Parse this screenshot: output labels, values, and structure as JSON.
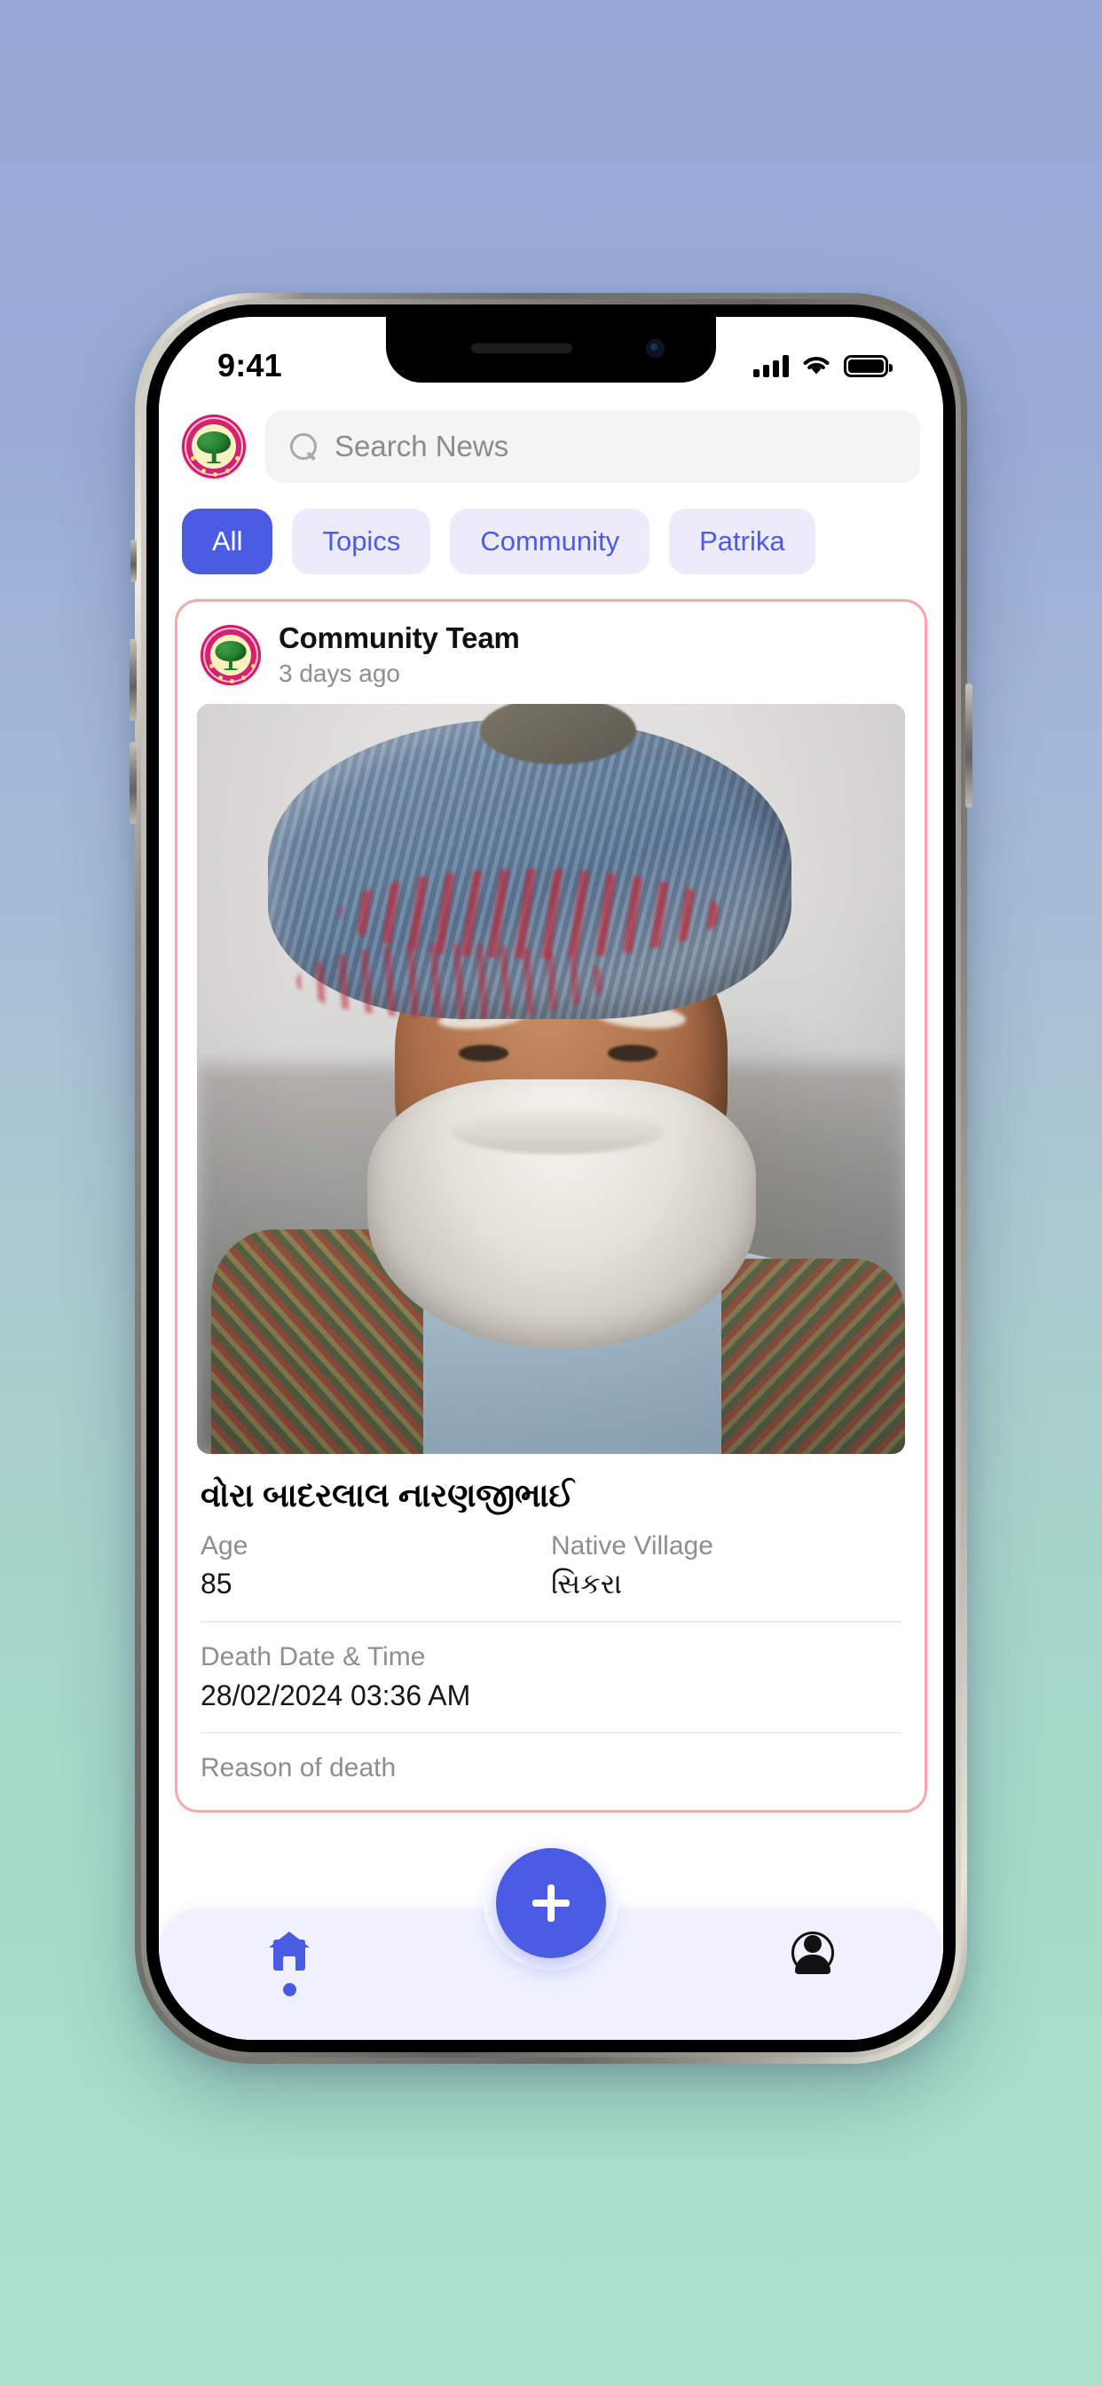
{
  "status_bar": {
    "time": "9:41",
    "cellular_icon": "cellular-signal-icon",
    "wifi_icon": "wifi-icon",
    "battery_icon": "battery-full-icon"
  },
  "header": {
    "logo_alt": "community-tree-emblem-logo",
    "search": {
      "placeholder": "Search News",
      "value": "",
      "icon": "search-icon"
    }
  },
  "filters": {
    "items": [
      {
        "label": "All",
        "active": true
      },
      {
        "label": "Topics",
        "active": false
      },
      {
        "label": "Community",
        "active": false
      },
      {
        "label": "Patrika",
        "active": false
      }
    ],
    "active_color": "#4a5ce4",
    "inactive_bg": "#eceafb",
    "inactive_text": "#4a5ce4"
  },
  "feed": {
    "post": {
      "avatar_alt": "community-tree-emblem-avatar",
      "author": "Community Team",
      "timestamp": "3 days ago",
      "photo_alt": "elderly-man-with-blue-turban-portrait",
      "deceased_name": "વોરા બાદરલાલ નારણજીભાઈ",
      "fields": [
        {
          "label": "Age",
          "value": "85"
        },
        {
          "label": "Native Village",
          "value": "સિકરા"
        }
      ],
      "death": {
        "label": "Death Date & Time",
        "value": "28/02/2024 03:36 AM"
      },
      "reason": {
        "label": "Reason of death",
        "value": ""
      },
      "card_border_color": "#f5a9ab"
    }
  },
  "bottom_nav": {
    "items": [
      {
        "name": "home",
        "icon": "home-icon",
        "active": true
      },
      {
        "name": "profile",
        "icon": "person-icon",
        "active": false
      }
    ],
    "fab": {
      "icon": "plus-icon",
      "color": "#4a5ce4"
    },
    "background": "#eff1fe"
  }
}
